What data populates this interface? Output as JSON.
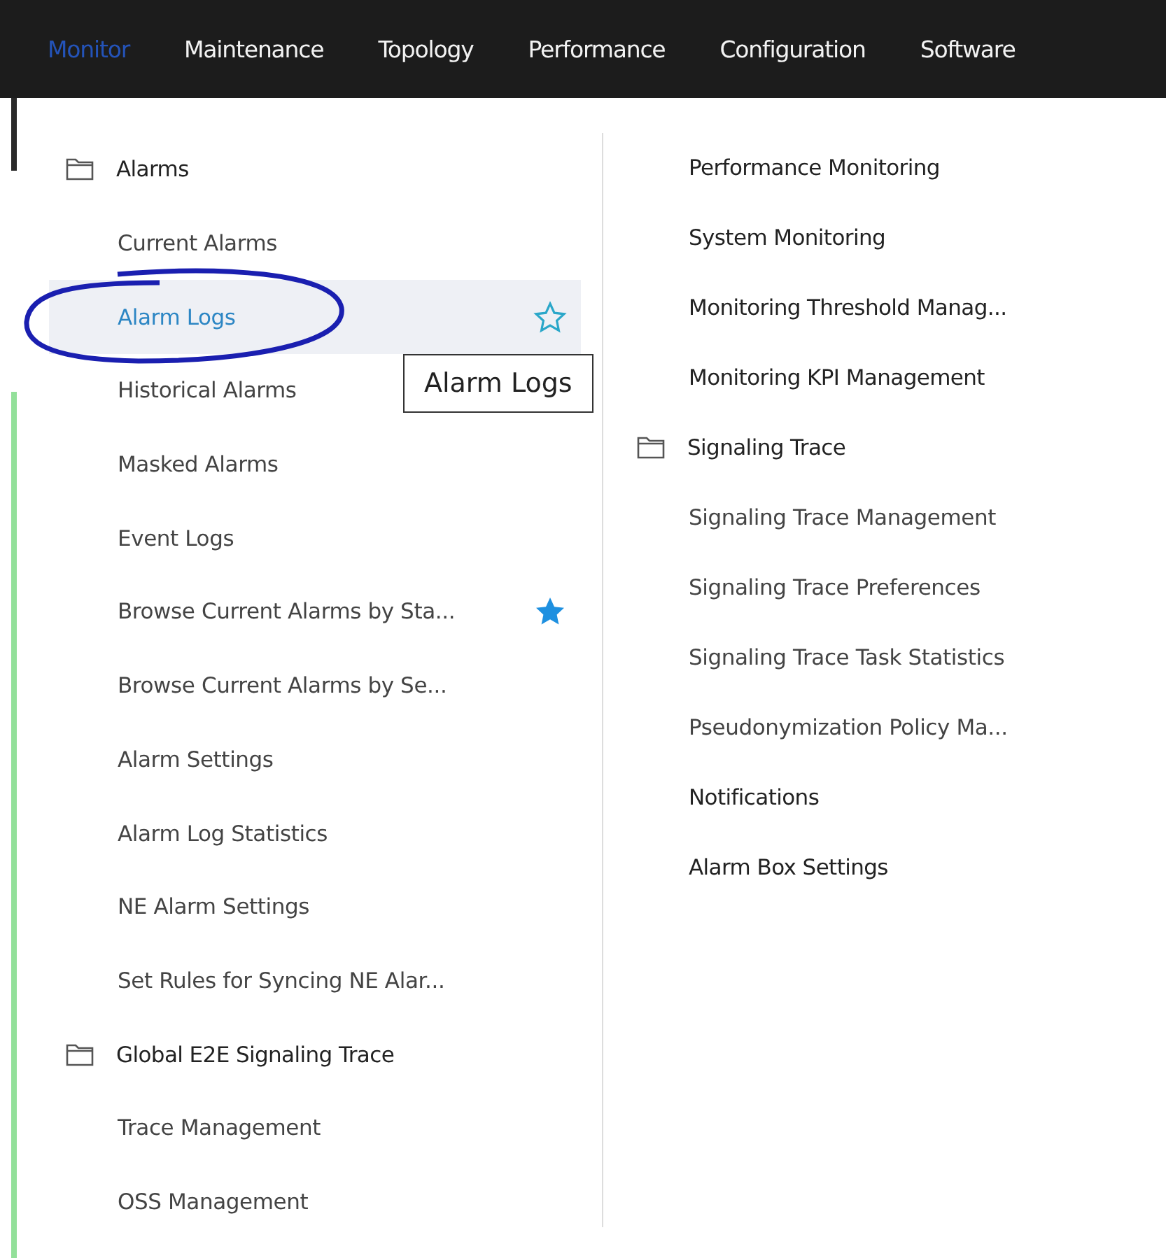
{
  "nav": [
    {
      "label": "Monitor",
      "selected": true
    },
    {
      "label": "Maintenance",
      "selected": false
    },
    {
      "label": "Topology",
      "selected": false
    },
    {
      "label": "Performance",
      "selected": false
    },
    {
      "label": "Configuration",
      "selected": false
    },
    {
      "label": "Software",
      "selected": false
    }
  ],
  "left_column": [
    {
      "kind": "group",
      "label": "Alarms"
    },
    {
      "kind": "item",
      "label": "Current Alarms",
      "selected": false,
      "starred": false
    },
    {
      "kind": "item",
      "label": "Alarm Logs",
      "selected": true,
      "starred": false
    },
    {
      "kind": "item",
      "label": "Historical Alarms",
      "selected": false,
      "starred": false
    },
    {
      "kind": "item",
      "label": "Masked Alarms",
      "selected": false,
      "starred": false
    },
    {
      "kind": "item",
      "label": "Event Logs",
      "selected": false,
      "starred": false
    },
    {
      "kind": "item",
      "label": "Browse Current Alarms by Sta...",
      "selected": false,
      "starred": true
    },
    {
      "kind": "item",
      "label": "Browse Current Alarms by Se...",
      "selected": false,
      "starred": false
    },
    {
      "kind": "item",
      "label": "Alarm Settings",
      "selected": false,
      "starred": false
    },
    {
      "kind": "item",
      "label": "Alarm Log Statistics",
      "selected": false,
      "starred": false
    },
    {
      "kind": "item",
      "label": "NE Alarm Settings",
      "selected": false,
      "starred": false
    },
    {
      "kind": "item",
      "label": "Set Rules for Syncing NE Alar...",
      "selected": false,
      "starred": false
    },
    {
      "kind": "group",
      "label": "Global E2E Signaling Trace"
    },
    {
      "kind": "item",
      "label": "Trace Management",
      "selected": false,
      "starred": false
    },
    {
      "kind": "item",
      "label": "OSS Management",
      "selected": false,
      "starred": false
    }
  ],
  "right_column": [
    {
      "kind": "heading",
      "label": "Performance Monitoring"
    },
    {
      "kind": "heading",
      "label": "System Monitoring"
    },
    {
      "kind": "heading",
      "label": "Monitoring Threshold Manag..."
    },
    {
      "kind": "heading",
      "label": "Monitoring KPI Management"
    },
    {
      "kind": "group",
      "label": "Signaling Trace"
    },
    {
      "kind": "item",
      "label": "Signaling Trace Management"
    },
    {
      "kind": "item",
      "label": "Signaling Trace Preferences"
    },
    {
      "kind": "item",
      "label": "Signaling Trace Task Statistics"
    },
    {
      "kind": "item",
      "label": "Pseudonymization Policy Ma..."
    },
    {
      "kind": "heading",
      "label": "Notifications"
    },
    {
      "kind": "heading",
      "label": "Alarm Box Settings"
    }
  ],
  "tooltip": {
    "text": "Alarm Logs"
  }
}
